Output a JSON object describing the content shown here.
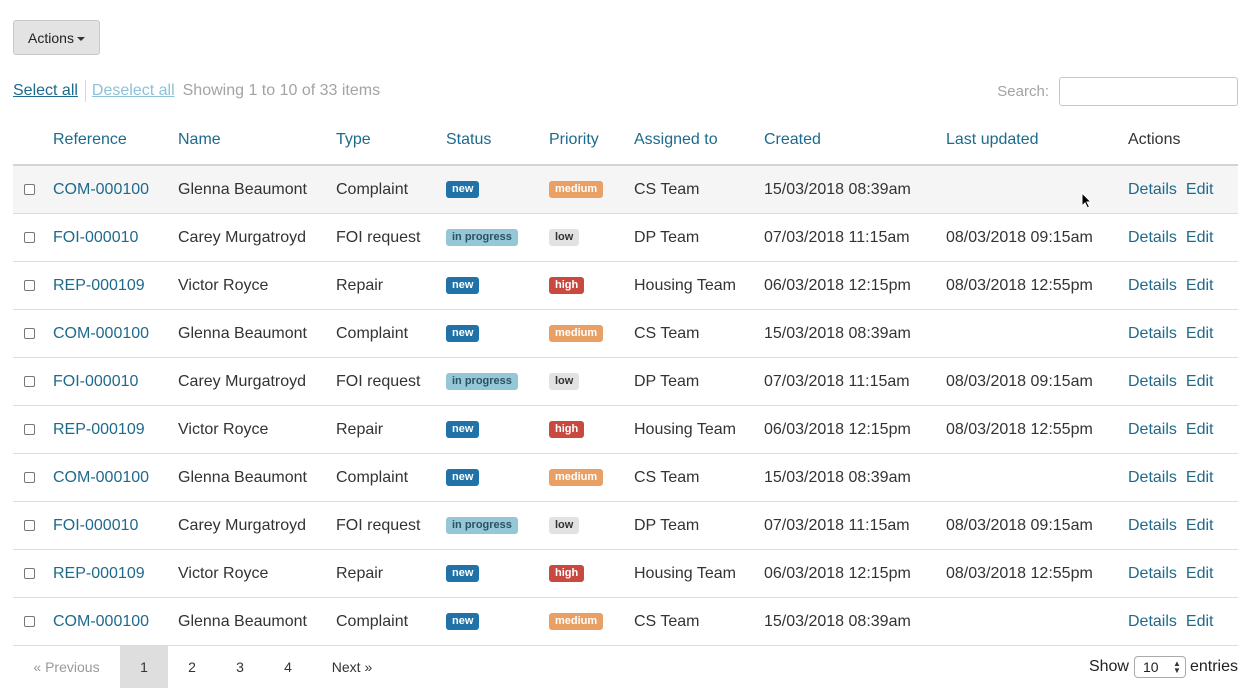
{
  "actions_button": {
    "label": "Actions"
  },
  "toolbar": {
    "select_all": "Select all",
    "deselect_all": "Deselect all",
    "showing": "Showing 1 to 10 of 33 items"
  },
  "search": {
    "label": "Search:",
    "value": "",
    "placeholder": ""
  },
  "table": {
    "headers": [
      "Reference",
      "Name",
      "Type",
      "Status",
      "Priority",
      "Assigned to",
      "Created",
      "Last updated",
      "Actions"
    ],
    "rows": [
      {
        "ref": "COM-000100",
        "name": "Glenna Beaumont",
        "type": "Complaint",
        "status": "new",
        "priority": "medium",
        "assigned": "CS Team",
        "created": "15/03/2018 08:39am",
        "updated": "",
        "details": "Details",
        "edit": "Edit"
      },
      {
        "ref": "FOI-000010",
        "name": "Carey Murgatroyd",
        "type": "FOI request",
        "status": "in progress",
        "priority": "low",
        "assigned": "DP Team",
        "created": "07/03/2018 11:15am",
        "updated": "08/03/2018 09:15am",
        "details": "Details",
        "edit": "Edit"
      },
      {
        "ref": "REP-000109",
        "name": "Victor Royce",
        "type": "Repair",
        "status": "new",
        "priority": "high",
        "assigned": "Housing Team",
        "created": "06/03/2018 12:15pm",
        "updated": "08/03/2018 12:55pm",
        "details": "Details",
        "edit": "Edit"
      },
      {
        "ref": "COM-000100",
        "name": "Glenna Beaumont",
        "type": "Complaint",
        "status": "new",
        "priority": "medium",
        "assigned": "CS Team",
        "created": "15/03/2018 08:39am",
        "updated": "",
        "details": "Details",
        "edit": "Edit"
      },
      {
        "ref": "FOI-000010",
        "name": "Carey Murgatroyd",
        "type": "FOI request",
        "status": "in progress",
        "priority": "low",
        "assigned": "DP Team",
        "created": "07/03/2018 11:15am",
        "updated": "08/03/2018 09:15am",
        "details": "Details",
        "edit": "Edit"
      },
      {
        "ref": "REP-000109",
        "name": "Victor Royce",
        "type": "Repair",
        "status": "new",
        "priority": "high",
        "assigned": "Housing Team",
        "created": "06/03/2018 12:15pm",
        "updated": "08/03/2018 12:55pm",
        "details": "Details",
        "edit": "Edit"
      },
      {
        "ref": "COM-000100",
        "name": "Glenna Beaumont",
        "type": "Complaint",
        "status": "new",
        "priority": "medium",
        "assigned": "CS Team",
        "created": "15/03/2018 08:39am",
        "updated": "",
        "details": "Details",
        "edit": "Edit"
      },
      {
        "ref": "FOI-000010",
        "name": "Carey Murgatroyd",
        "type": "FOI request",
        "status": "in progress",
        "priority": "low",
        "assigned": "DP Team",
        "created": "07/03/2018 11:15am",
        "updated": "08/03/2018 09:15am",
        "details": "Details",
        "edit": "Edit"
      },
      {
        "ref": "REP-000109",
        "name": "Victor Royce",
        "type": "Repair",
        "status": "new",
        "priority": "high",
        "assigned": "Housing Team",
        "created": "06/03/2018 12:15pm",
        "updated": "08/03/2018 12:55pm",
        "details": "Details",
        "edit": "Edit"
      },
      {
        "ref": "COM-000100",
        "name": "Glenna Beaumont",
        "type": "Complaint",
        "status": "new",
        "priority": "medium",
        "assigned": "CS Team",
        "created": "15/03/2018 08:39am",
        "updated": "",
        "details": "Details",
        "edit": "Edit"
      }
    ]
  },
  "pagination": {
    "previous": "« Previous",
    "pages": [
      "1",
      "2",
      "3",
      "4"
    ],
    "active_page": "1",
    "next": "Next »"
  },
  "entries": {
    "show": "Show",
    "value": "10",
    "suffix": "entries"
  },
  "colors": {
    "link": "#1e6a8c",
    "badge_new": "#2072a8",
    "badge_in_progress": "#96c7d9",
    "badge_medium": "#e8a065",
    "badge_low": "#e2e2e2",
    "badge_high": "#c9483f",
    "row_hover": "#f5f5f5"
  },
  "icons": {
    "actions_caret": "caret-down-icon",
    "mouse_cursor": "mouse-pointer-icon",
    "entries_arrows": "select-arrows-icon"
  }
}
